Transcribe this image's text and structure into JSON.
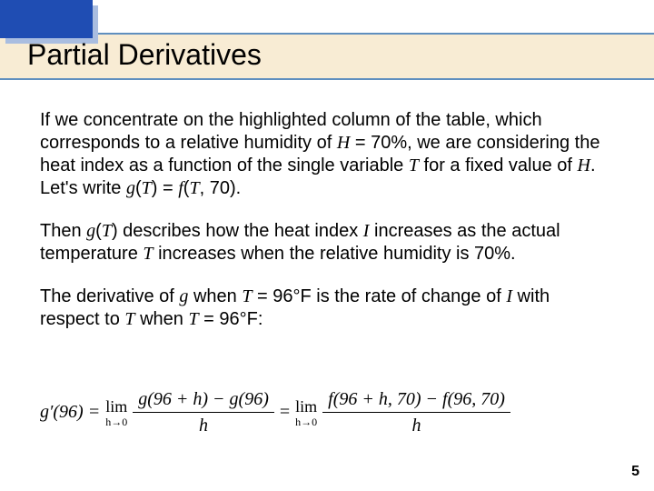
{
  "header": {
    "title": "Partial Derivatives"
  },
  "paragraphs": {
    "p1_a": "If we concentrate on the highlighted column of the table, which corresponds to a relative humidity of ",
    "p1_b": " = 70%, we are considering the heat index as a function of the single variable ",
    "p1_c": " for a fixed value of ",
    "p1_d": ". Let's write ",
    "p1_e": ") = ",
    "p1_f": ", 70).",
    "p2_a": "Then ",
    "p2_b": ") describes how the heat index ",
    "p2_c": " increases as the actual temperature ",
    "p2_d": " increases when the relative humidity is 70%.",
    "p3_a": "The derivative of ",
    "p3_b": " when ",
    "p3_c": " = 96°F is the rate of change of ",
    "p3_d": " with respect to ",
    "p3_e": " when ",
    "p3_f": " = 96°F:"
  },
  "vars": {
    "H": "H",
    "T": "T",
    "g": "g",
    "f": "f",
    "I": "I"
  },
  "equation": {
    "lhs": "g′(96) = ",
    "lim_top": "lim",
    "lim_bot": "h→0",
    "frac1_num": "g(96 + h) − g(96)",
    "frac1_den": "h",
    "eq_mid": " = ",
    "frac2_num": "f(96 + h, 70) − f(96, 70)",
    "frac2_den": "h"
  },
  "page_number": "5"
}
